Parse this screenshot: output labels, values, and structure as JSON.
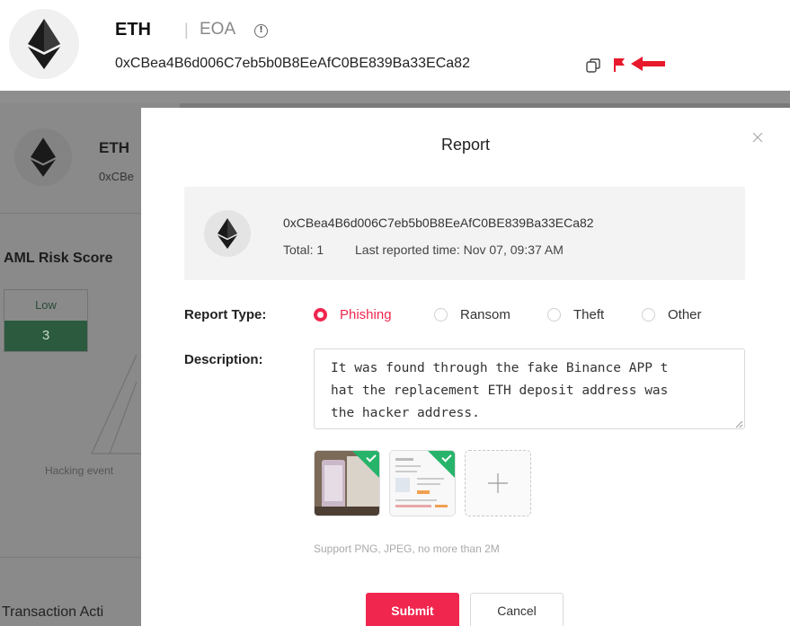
{
  "header": {
    "title": "ETH",
    "separator": "|",
    "account_type": "EOA",
    "info_glyph": "!",
    "address": "0xCBea4B6d006C7eb5b0B8EeAfC0BE839Ba33ECa82",
    "icons": [
      "ethereum-logo",
      "info-icon",
      "copy-icon",
      "flag-icon",
      "red-arrow-icon"
    ]
  },
  "background_page": {
    "title": "ETH",
    "address_fragment": "0xCBe",
    "aml_title": "AML Risk Score",
    "risk_level": "Low",
    "risk_score": "3",
    "chart_label": "Hacking event",
    "section_title": "Transaction Acti"
  },
  "modal": {
    "title": "Report",
    "close_glyph": "×",
    "summary": {
      "address": "0xCBea4B6d006C7eb5b0B8EeAfC0BE839Ba33ECa82",
      "total": "Total: 1",
      "last_reported": "Last reported time: Nov 07, 09:37 AM"
    },
    "report_type_label": "Report Type:",
    "report_types": [
      {
        "label": "Phishing",
        "checked": true
      },
      {
        "label": "Ransom",
        "checked": false
      },
      {
        "label": "Theft",
        "checked": false
      },
      {
        "label": "Other",
        "checked": false
      }
    ],
    "description_label": "Description:",
    "description_lines": [
      "It was found through the fake Binance APP t",
      "hat the replacement ETH deposit address was",
      "the hacker address."
    ],
    "upload_hint": "Support PNG, JPEG, no more than 2M",
    "submit_label": "Submit",
    "cancel_label": "Cancel"
  },
  "colors": {
    "accent": "#f0264e",
    "success": "#27b46a",
    "overlay": "#7a7a7a",
    "low_risk": "#2b5a3e"
  }
}
